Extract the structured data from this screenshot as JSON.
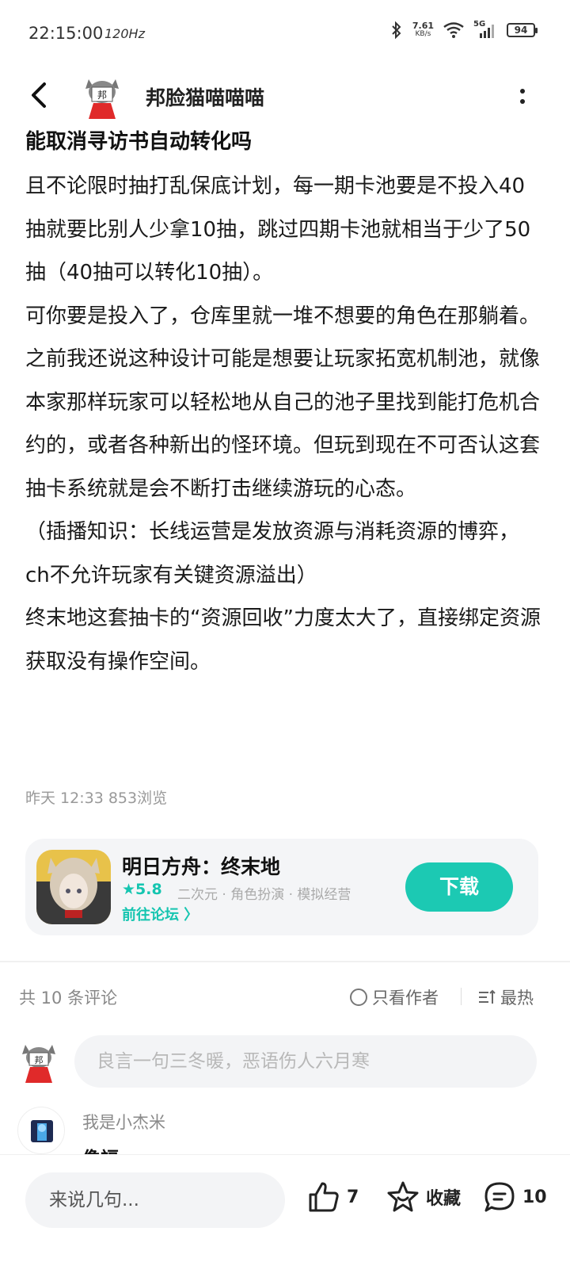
{
  "status_bar": {
    "time": "22:15:00",
    "refresh_rate": "120Hz",
    "net_speed_value": "7.61",
    "net_speed_unit": "KB/s",
    "network": "5G",
    "battery": "94"
  },
  "header": {
    "author_name": "邦脸猫喵喵喵"
  },
  "post": {
    "title": "能取消寻访书自动转化吗",
    "paragraphs": [
      "且不论限时抽打乱保底计划，每一期卡池要是不投入40抽就要比别人少拿10抽，跳过四期卡池就相当于少了50抽（40抽可以转化10抽）。",
      "可你要是投入了，仓库里就一堆不想要的角色在那躺着。",
      "之前我还说这种设计可能是想要让玩家拓宽机制池，就像本家那样玩家可以轻松地从自己的池子里找到能打危机合约的，或者各种新出的怪环境。但玩到现在不可否认这套抽卡系统就是会不断打击继续游玩的心态。",
      "（插播知识：长线运营是发放资源与消耗资源的博弈，ch不允许玩家有关键资源溢出）",
      "终末地这套抽卡的“资源回收”力度太大了，直接绑定资源获取没有操作空间。"
    ],
    "meta": "昨天 12:33  853浏览"
  },
  "app_card": {
    "name": "明日方舟：终末地",
    "rating": "★5.8",
    "tags": "二次元 · 角色扮演 · 模拟经营",
    "forum_link": "前往论坛 〉",
    "download_label": "下载",
    "accent_color": "#1cc9b3"
  },
  "comments": {
    "count_label": "共 10 条评论",
    "only_author_label": "只看作者",
    "sort_label": "最热",
    "input_placeholder": "良言一句三冬暖，恶语伤人六月寒",
    "items": [
      {
        "user": "我是小杰米",
        "text": "像福"
      }
    ]
  },
  "bottom_bar": {
    "say_placeholder": "来说几句...",
    "like_count": "7",
    "favorite_label": "收藏",
    "comment_count": "10"
  }
}
